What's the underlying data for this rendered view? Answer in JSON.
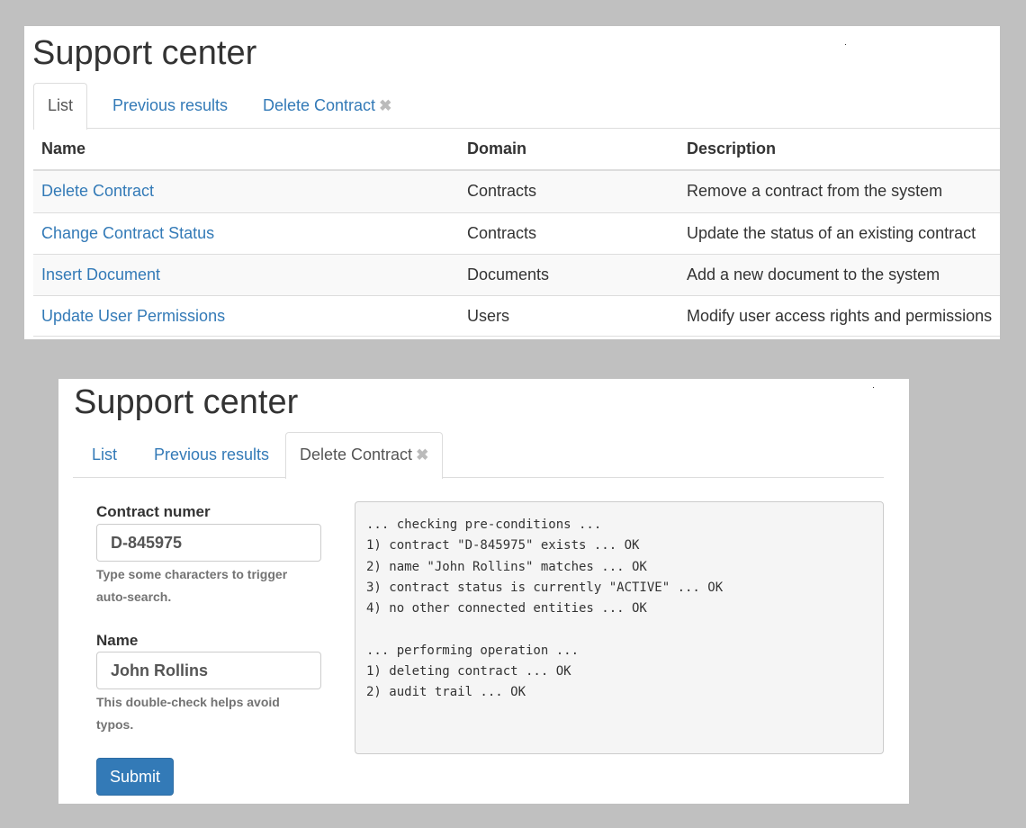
{
  "top_panel": {
    "title": "Support center",
    "tabs": [
      {
        "label": "List",
        "active": true
      },
      {
        "label": "Previous results",
        "active": false
      },
      {
        "label": "Delete Contract",
        "active": false,
        "closable": true
      }
    ],
    "table": {
      "headers": [
        "Name",
        "Domain",
        "Description"
      ],
      "rows": [
        {
          "name": "Delete Contract",
          "domain": "Contracts",
          "description": "Remove a contract from the system"
        },
        {
          "name": "Change Contract Status",
          "domain": "Contracts",
          "description": "Update the status of an existing contract"
        },
        {
          "name": "Insert Document",
          "domain": "Documents",
          "description": "Add a new document to the system"
        },
        {
          "name": "Update User Permissions",
          "domain": "Users",
          "description": "Modify user access rights and permissions"
        }
      ]
    }
  },
  "bottom_panel": {
    "title": "Support center",
    "tabs": [
      {
        "label": "List",
        "active": false
      },
      {
        "label": "Previous results",
        "active": false
      },
      {
        "label": "Delete Contract",
        "active": true,
        "closable": true
      }
    ],
    "form": {
      "contract_label": "Contract numer",
      "contract_value": "D-845975",
      "contract_help": "Type some characters to trigger auto-search.",
      "name_label": "Name",
      "name_value": "John Rollins",
      "name_help": "This double-check helps avoid typos.",
      "submit_label": "Submit"
    },
    "output_lines": [
      "... checking pre-conditions ...",
      "1) contract \"D-845975\" exists ... OK",
      "2) name \"John Rollins\" matches ... OK",
      "3) contract status is currently \"ACTIVE\" ... OK",
      "4) no other connected entities ... OK",
      "",
      "... performing operation ...",
      "1) deleting contract ... OK",
      "2) audit trail ... OK"
    ]
  },
  "icons": {
    "close_tab": "close-icon"
  },
  "colors": {
    "link": "#337ab7",
    "primary_button": "#337ab7",
    "background": "#c0c0c0"
  }
}
